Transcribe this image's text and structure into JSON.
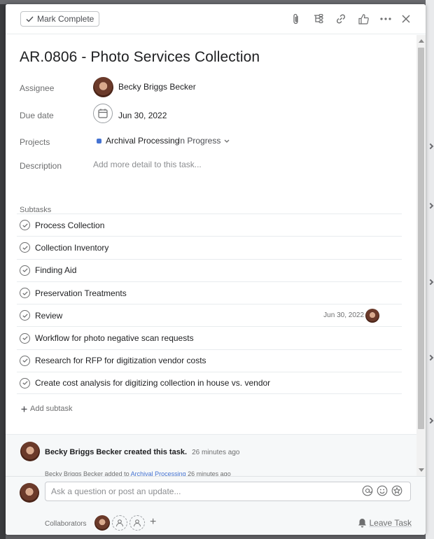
{
  "toolbar": {
    "mark_complete_label": "Mark Complete",
    "icons": [
      "paperclip-icon",
      "subtask-icon",
      "link-icon",
      "thumbs-up-icon",
      "more-icon",
      "close-icon"
    ]
  },
  "task": {
    "title": "AR.0806 - Photo Services Collection",
    "fields": {
      "assignee_label": "Assignee",
      "assignee_name": "Becky Briggs Becker",
      "due_label": "Due date",
      "due_value": "Jun 30, 2022",
      "projects_label": "Projects",
      "project_name": "Archival Processing",
      "project_color": "#4573d2",
      "project_status": "In Progress",
      "description_label": "Description",
      "description_placeholder": "Add more detail to this task..."
    }
  },
  "subtasks": {
    "label": "Subtasks",
    "items": [
      {
        "name": "Process Collection"
      },
      {
        "name": "Collection Inventory"
      },
      {
        "name": "Finding Aid"
      },
      {
        "name": "Preservation Treatments"
      },
      {
        "name": "Review",
        "due": "Jun 30, 2022"
      },
      {
        "name": "Workflow for photo negative scan requests"
      },
      {
        "name": "Research for RFP for digitization vendor costs"
      },
      {
        "name": "Create cost analysis for digitizing collection in house vs. vendor"
      }
    ],
    "add_label": "Add subtask"
  },
  "activity": {
    "creator": "Becky Briggs Becker",
    "action": "created this task.",
    "time": "26 minutes ago",
    "line2_actor": "Becky Briggs Becker",
    "line2_action": "added to",
    "line2_project": "Archival Processing",
    "line2_time": "26 minutes ago"
  },
  "comment": {
    "placeholder": "Ask a question or post an update..."
  },
  "collaborators": {
    "label": "Collaborators",
    "leave_label": "Leave Task"
  }
}
